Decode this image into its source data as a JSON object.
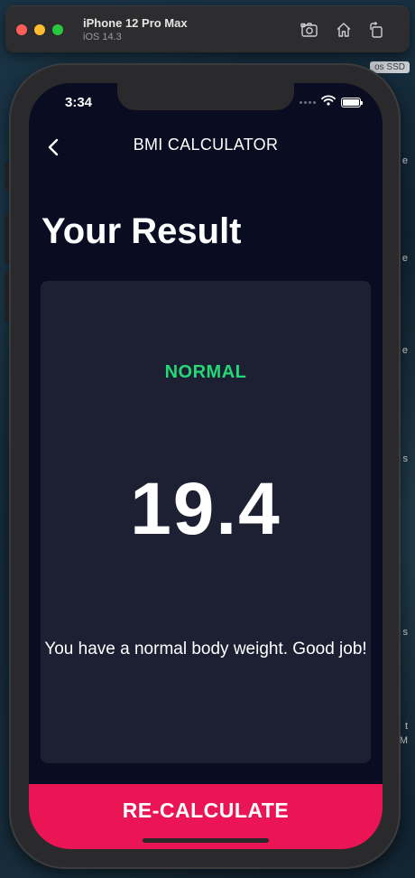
{
  "simulator": {
    "device_name": "iPhone 12 Pro Max",
    "os_version": "iOS 14.3",
    "toolbar_icons": [
      "screenshot-icon",
      "home-icon",
      "rotate-icon"
    ]
  },
  "desktop": {
    "disk_label": "os SSD",
    "edge_fragments": [
      "e",
      "e",
      "e",
      "s",
      "s",
      "t",
      "M"
    ]
  },
  "status_bar": {
    "time": "3:34",
    "icons": [
      "signal-dots-icon",
      "wifi-icon",
      "battery-icon"
    ]
  },
  "nav": {
    "back_icon": "chevron-left-icon",
    "title": "BMI CALCULATOR"
  },
  "page": {
    "heading": "Your Result"
  },
  "result": {
    "category": "NORMAL",
    "bmi_value": "19.4",
    "message": "You have a normal body weight. Good job!"
  },
  "action": {
    "button_label": "RE-CALCULATE"
  },
  "colors": {
    "background": "#0a0d22",
    "card": "#1d1f33",
    "category_green": "#24d876",
    "button_pink": "#eb1555",
    "text": "#ffffff"
  }
}
